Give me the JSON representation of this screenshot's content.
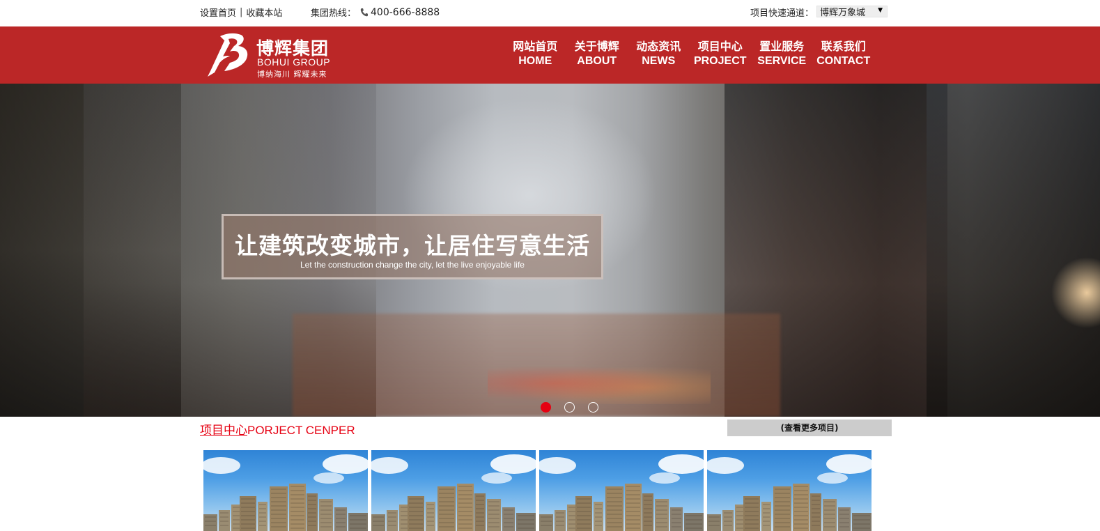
{
  "topbar": {
    "set_home": "设置首页",
    "separator": "|",
    "bookmark": "收藏本站",
    "hotline_label": "集团热线：",
    "hotline_number": "400-666-8888",
    "quick_label": "项目快速通道：",
    "quick_selected": "博辉万象城"
  },
  "logo": {
    "name": "博辉集团",
    "en": "BOHUI GROUP",
    "slogan": "博纳海川 辉耀未来"
  },
  "nav": {
    "items": [
      {
        "cn": "网站首页",
        "en": "HOME"
      },
      {
        "cn": "关于博辉",
        "en": "ABOUT"
      },
      {
        "cn": "动态资讯",
        "en": "NEWS"
      },
      {
        "cn": "项目中心",
        "en": "PROJECT"
      },
      {
        "cn": "置业服务",
        "en": "SERVICE"
      },
      {
        "cn": "联系我们",
        "en": "CONTACT"
      }
    ]
  },
  "banner": {
    "title": "让建筑改变城市，让居住写意生活",
    "subtitle": "Let the construction change the city, let the live enjoyable life",
    "slide_count": 3,
    "active_slide": 1
  },
  "projects": {
    "title_cn": "项目中心",
    "title_en": "PORJECT CENPER",
    "more_label": "(查看更多项目)"
  },
  "colors": {
    "brand_red": "#bb2727",
    "accent_red": "#e60012"
  }
}
